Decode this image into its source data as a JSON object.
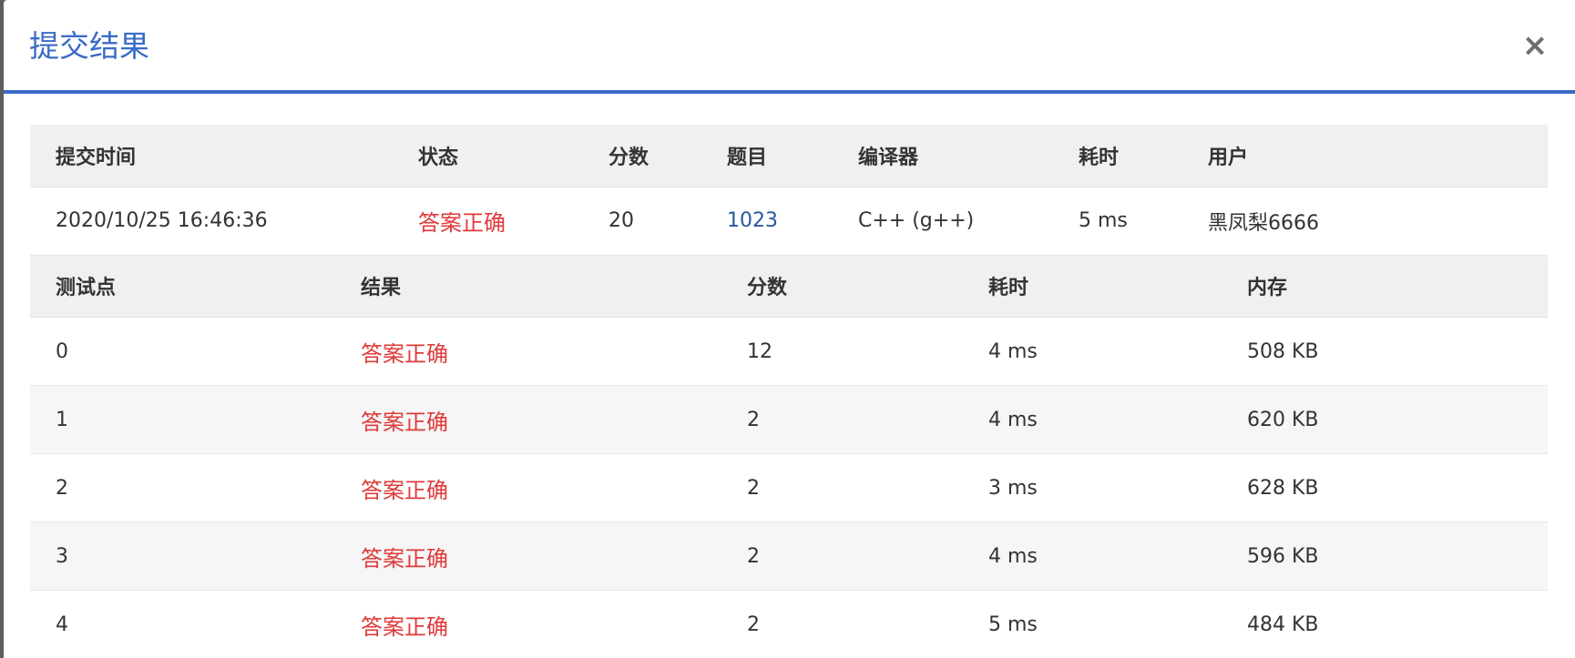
{
  "dialog": {
    "title": "提交结果",
    "close_symbol": "×"
  },
  "summary": {
    "headers": {
      "time": "提交时间",
      "status": "状态",
      "score": "分数",
      "problem": "题目",
      "compiler": "编译器",
      "duration": "耗时",
      "user": "用户"
    },
    "row": {
      "time": "2020/10/25 16:46:36",
      "status": "答案正确",
      "score": "20",
      "problem": "1023",
      "compiler": "C++ (g++)",
      "duration": "5 ms",
      "user": "黑凤梨6666"
    }
  },
  "cases": {
    "headers": {
      "case": "测试点",
      "result": "结果",
      "score": "分数",
      "duration": "耗时",
      "memory": "内存"
    },
    "rows": [
      {
        "case": "0",
        "result": "答案正确",
        "score": "12",
        "duration": "4 ms",
        "memory": "508 KB"
      },
      {
        "case": "1",
        "result": "答案正确",
        "score": "2",
        "duration": "4 ms",
        "memory": "620 KB"
      },
      {
        "case": "2",
        "result": "答案正确",
        "score": "2",
        "duration": "3 ms",
        "memory": "628 KB"
      },
      {
        "case": "3",
        "result": "答案正确",
        "score": "2",
        "duration": "4 ms",
        "memory": "596 KB"
      },
      {
        "case": "4",
        "result": "答案正确",
        "score": "2",
        "duration": "5 ms",
        "memory": "484 KB"
      }
    ]
  },
  "colors": {
    "accent": "#3a6bc6",
    "status_ok": "#e03a3a",
    "link": "#245a9e"
  }
}
